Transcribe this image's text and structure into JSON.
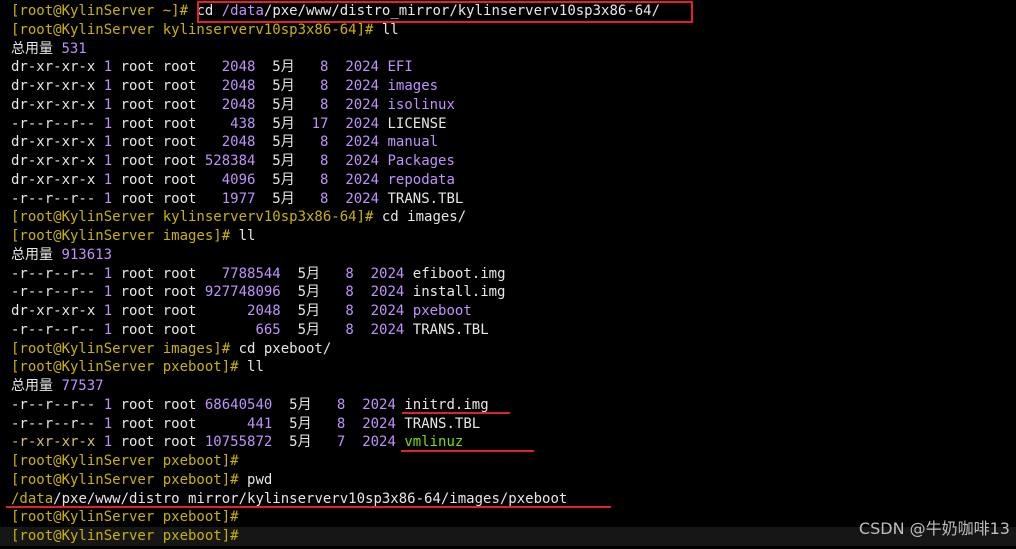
{
  "colors": {
    "background": "#000000",
    "bracket": "#c9b300",
    "number": "#bd93f9",
    "directory": "#bd93f9",
    "executable": "#7fdc00",
    "highlight": "#e0202a"
  },
  "lines": {
    "l1": {
      "prompt": "[root@KylinServer ~]# ",
      "cmd_a": "cd ",
      "cmd_b": "/data",
      "cmd_c": "/pxe/www/distro_mirror/kylinserverv10sp3x86-64/"
    },
    "l2": {
      "prompt": "[root@KylinServer kylinserverv10sp3x86-64]# ",
      "cmd": "ll"
    },
    "l3": {
      "label": "总用量 ",
      "value": "531"
    },
    "r1": {
      "perm": "dr-xr-xr-x ",
      "links": "1",
      "owner": " root root   ",
      "size": "2048",
      "date_a": "  5月   ",
      "day": "8",
      "date_b": "  ",
      "year": "2024",
      "sp": " ",
      "name": "EFI"
    },
    "r2": {
      "perm": "dr-xr-xr-x ",
      "links": "1",
      "owner": " root root   ",
      "size": "2048",
      "date_a": "  5月   ",
      "day": "8",
      "date_b": "  ",
      "year": "2024",
      "sp": " ",
      "name": "images"
    },
    "r3": {
      "perm": "dr-xr-xr-x ",
      "links": "1",
      "owner": " root root   ",
      "size": "2048",
      "date_a": "  5月   ",
      "day": "8",
      "date_b": "  ",
      "year": "2024",
      "sp": " ",
      "name": "isolinux"
    },
    "r4": {
      "perm": "-r--r--r-- ",
      "links": "1",
      "owner": " root root    ",
      "size": "438",
      "date_a": "  5月  ",
      "day": "17",
      "date_b": "  ",
      "year": "2024",
      "sp": " ",
      "name": "LICENSE"
    },
    "r5": {
      "perm": "dr-xr-xr-x ",
      "links": "1",
      "owner": " root root   ",
      "size": "2048",
      "date_a": "  5月   ",
      "day": "8",
      "date_b": "  ",
      "year": "2024",
      "sp": " ",
      "name": "manual"
    },
    "r6": {
      "perm": "dr-xr-xr-x ",
      "links": "1",
      "owner": " root root ",
      "size": "528384",
      "date_a": "  5月   ",
      "day": "8",
      "date_b": "  ",
      "year": "2024",
      "sp": " ",
      "name": "Packages"
    },
    "r7": {
      "perm": "dr-xr-xr-x ",
      "links": "1",
      "owner": " root root   ",
      "size": "4096",
      "date_a": "  5月   ",
      "day": "8",
      "date_b": "  ",
      "year": "2024",
      "sp": " ",
      "name": "repodata"
    },
    "r8": {
      "perm": "-r--r--r-- ",
      "links": "1",
      "owner": " root root   ",
      "size": "1977",
      "date_a": "  5月   ",
      "day": "8",
      "date_b": "  ",
      "year": "2024",
      "sp": " ",
      "name": "TRANS.TBL"
    },
    "l12": {
      "prompt": "[root@KylinServer kylinserverv10sp3x86-64]# ",
      "cmd": "cd images/"
    },
    "l13": {
      "prompt": "[root@KylinServer images]# ",
      "cmd": "ll"
    },
    "l14": {
      "label": "总用量 ",
      "value": "913613"
    },
    "s1": {
      "perm": "-r--r--r-- ",
      "links": "1",
      "owner": " root root   ",
      "size": "7788544",
      "date_a": "  5月   ",
      "day": "8",
      "date_b": "  ",
      "year": "2024",
      "sp": " ",
      "name": "efiboot.img"
    },
    "s2": {
      "perm": "-r--r--r-- ",
      "links": "1",
      "owner": " root root ",
      "size": "927748096",
      "date_a": "  5月   ",
      "day": "8",
      "date_b": "  ",
      "year": "2024",
      "sp": " ",
      "name": "install.img"
    },
    "s3": {
      "perm": "dr-xr-xr-x ",
      "links": "1",
      "owner": " root root      ",
      "size": "2048",
      "date_a": "  5月   ",
      "day": "8",
      "date_b": "  ",
      "year": "2024",
      "sp": " ",
      "name": "pxeboot"
    },
    "s4": {
      "perm": "-r--r--r-- ",
      "links": "1",
      "owner": " root root       ",
      "size": "665",
      "date_a": "  5月   ",
      "day": "8",
      "date_b": "  ",
      "year": "2024",
      "sp": " ",
      "name": "TRANS.TBL"
    },
    "l19": {
      "prompt": "[root@KylinServer images]# ",
      "cmd": "cd pxeboot/"
    },
    "l20": {
      "prompt": "[root@KylinServer pxeboot]# ",
      "cmd": "ll"
    },
    "l21": {
      "label": "总用量 ",
      "value": "77537"
    },
    "t1": {
      "perm": "-r--r--r-- ",
      "links": "1",
      "owner": " root root ",
      "size": "68640540",
      "date_a": "  5月   ",
      "day": "8",
      "date_b": "  ",
      "year": "2024",
      "sp": " ",
      "name": "initrd.img"
    },
    "t2": {
      "perm": "-r--r--r-- ",
      "links": "1",
      "owner": " root root      ",
      "size": "441",
      "date_a": "  5月   ",
      "day": "8",
      "date_b": "  ",
      "year": "2024",
      "sp": " ",
      "name": "TRANS.TBL"
    },
    "t3": {
      "perm": "-r-xr-xr-x ",
      "links": "1",
      "owner": " root root ",
      "size": "10755872",
      "date_a": "  5月   ",
      "day": "7",
      "date_b": "  ",
      "year": "2024",
      "sp": " ",
      "name": "vmlinuz"
    },
    "l25": {
      "prompt": "[root@KylinServer pxeboot]# ",
      "cmd": ""
    },
    "l26": {
      "prompt": "[root@KylinServer pxeboot]# ",
      "cmd": "pwd"
    },
    "l27": {
      "a": "/data",
      "b": "/pxe/www/distro_mirror/kylinserverv10sp3x86-64/images/pxeboot"
    },
    "l28": {
      "prompt": "[root@KylinServer pxeboot]# ",
      "cmd": ""
    },
    "l29": {
      "prompt": "[root@KylinServer pxeboot]# ",
      "cmd": ""
    }
  },
  "watermark": "CSDN @牛奶咖啡13"
}
